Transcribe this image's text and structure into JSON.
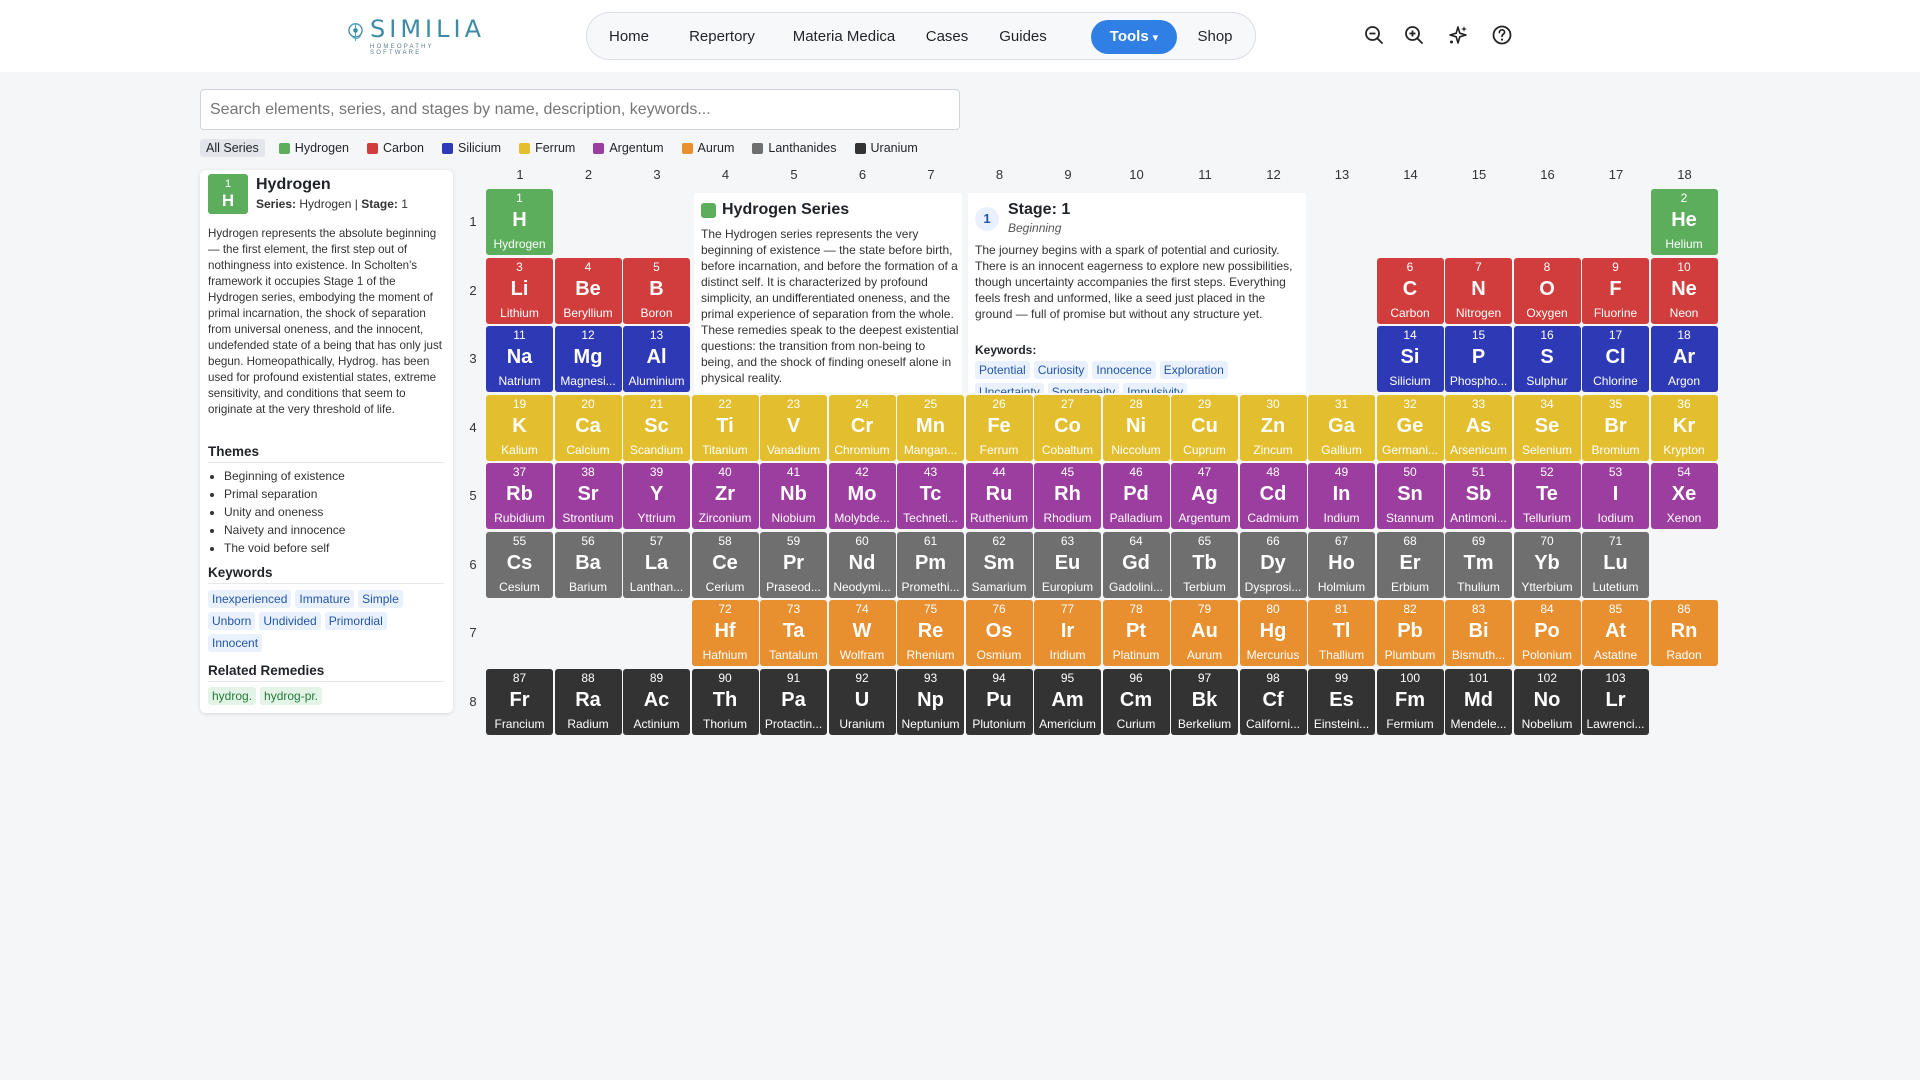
{
  "brand": {
    "name": "SIMILIA",
    "tagline": "HOMEOPATHY SOFTWARE"
  },
  "nav": [
    {
      "label": "Home"
    },
    {
      "label": "Repertory"
    },
    {
      "label": "Materia Medica"
    },
    {
      "label": "Cases"
    },
    {
      "label": "Guides"
    },
    {
      "label": "Tools",
      "active": true,
      "dropdown": true
    },
    {
      "label": "Shop"
    }
  ],
  "header_icons": [
    "zoom-out-icon",
    "zoom-in-icon",
    "sparkles-icon",
    "help-circle-icon"
  ],
  "search": {
    "placeholder": "Search elements, series, and stages by name, description, keywords...",
    "value": ""
  },
  "filters": [
    {
      "label": "All Series",
      "selected": true
    },
    {
      "label": "Hydrogen",
      "color": "#5cae5c"
    },
    {
      "label": "Carbon",
      "color": "#d13c3c"
    },
    {
      "label": "Silicium",
      "color": "#2e3ab5"
    },
    {
      "label": "Ferrum",
      "color": "#e3bf2f"
    },
    {
      "label": "Argentum",
      "color": "#9c3ea0"
    },
    {
      "label": "Aurum",
      "color": "#e88f2f"
    },
    {
      "label": "Lanthanides",
      "color": "#6f6f6f"
    },
    {
      "label": "Uranium",
      "color": "#333333"
    }
  ],
  "series_colors": {
    "hydrogen": "#5cae5c",
    "carbon": "#d13c3c",
    "silicium": "#2e3ab5",
    "ferrum": "#e3bf2f",
    "argentum": "#9c3ea0",
    "lanthanides": "#6f6f6f",
    "aurum": "#e88f2f",
    "uranium": "#333333"
  },
  "columns": [
    "1",
    "2",
    "3",
    "4",
    "5",
    "6",
    "7",
    "8",
    "9",
    "10",
    "11",
    "12",
    "13",
    "14",
    "15",
    "16",
    "17",
    "18"
  ],
  "rows": [
    "1",
    "2",
    "3",
    "4",
    "5",
    "6",
    "7",
    "8"
  ],
  "elements": [
    {
      "n": "1",
      "s": "H",
      "name": "Hydrogen",
      "series": "hydrogen",
      "row": 1,
      "col": 1
    },
    {
      "n": "2",
      "s": "He",
      "name": "Helium",
      "series": "hydrogen",
      "row": 1,
      "col": 18
    },
    {
      "n": "3",
      "s": "Li",
      "name": "Lithium",
      "series": "carbon",
      "row": 2,
      "col": 1
    },
    {
      "n": "4",
      "s": "Be",
      "name": "Beryllium",
      "series": "carbon",
      "row": 2,
      "col": 2
    },
    {
      "n": "5",
      "s": "B",
      "name": "Boron",
      "series": "carbon",
      "row": 2,
      "col": 3
    },
    {
      "n": "6",
      "s": "C",
      "name": "Carbon",
      "series": "carbon",
      "row": 2,
      "col": 14
    },
    {
      "n": "7",
      "s": "N",
      "name": "Nitrogen",
      "series": "carbon",
      "row": 2,
      "col": 15
    },
    {
      "n": "8",
      "s": "O",
      "name": "Oxygen",
      "series": "carbon",
      "row": 2,
      "col": 16
    },
    {
      "n": "9",
      "s": "F",
      "name": "Fluorine",
      "series": "carbon",
      "row": 2,
      "col": 17
    },
    {
      "n": "10",
      "s": "Ne",
      "name": "Neon",
      "series": "carbon",
      "row": 2,
      "col": 18
    },
    {
      "n": "11",
      "s": "Na",
      "name": "Natrium",
      "series": "silicium",
      "row": 3,
      "col": 1
    },
    {
      "n": "12",
      "s": "Mg",
      "name": "Magnesi...",
      "series": "silicium",
      "row": 3,
      "col": 2
    },
    {
      "n": "13",
      "s": "Al",
      "name": "Aluminium",
      "series": "silicium",
      "row": 3,
      "col": 3
    },
    {
      "n": "14",
      "s": "Si",
      "name": "Silicium",
      "series": "silicium",
      "row": 3,
      "col": 14
    },
    {
      "n": "15",
      "s": "P",
      "name": "Phospho...",
      "series": "silicium",
      "row": 3,
      "col": 15
    },
    {
      "n": "16",
      "s": "S",
      "name": "Sulphur",
      "series": "silicium",
      "row": 3,
      "col": 16
    },
    {
      "n": "17",
      "s": "Cl",
      "name": "Chlorine",
      "series": "silicium",
      "row": 3,
      "col": 17
    },
    {
      "n": "18",
      "s": "Ar",
      "name": "Argon",
      "series": "silicium",
      "row": 3,
      "col": 18
    },
    {
      "n": "19",
      "s": "K",
      "name": "Kalium",
      "series": "ferrum",
      "row": 4,
      "col": 1
    },
    {
      "n": "20",
      "s": "Ca",
      "name": "Calcium",
      "series": "ferrum",
      "row": 4,
      "col": 2
    },
    {
      "n": "21",
      "s": "Sc",
      "name": "Scandium",
      "series": "ferrum",
      "row": 4,
      "col": 3
    },
    {
      "n": "22",
      "s": "Ti",
      "name": "Titanium",
      "series": "ferrum",
      "row": 4,
      "col": 4
    },
    {
      "n": "23",
      "s": "V",
      "name": "Vanadium",
      "series": "ferrum",
      "row": 4,
      "col": 5
    },
    {
      "n": "24",
      "s": "Cr",
      "name": "Chromium",
      "series": "ferrum",
      "row": 4,
      "col": 6
    },
    {
      "n": "25",
      "s": "Mn",
      "name": "Mangan...",
      "series": "ferrum",
      "row": 4,
      "col": 7
    },
    {
      "n": "26",
      "s": "Fe",
      "name": "Ferrum",
      "series": "ferrum",
      "row": 4,
      "col": 8
    },
    {
      "n": "27",
      "s": "Co",
      "name": "Cobaltum",
      "series": "ferrum",
      "row": 4,
      "col": 9
    },
    {
      "n": "28",
      "s": "Ni",
      "name": "Niccolum",
      "series": "ferrum",
      "row": 4,
      "col": 10
    },
    {
      "n": "29",
      "s": "Cu",
      "name": "Cuprum",
      "series": "ferrum",
      "row": 4,
      "col": 11
    },
    {
      "n": "30",
      "s": "Zn",
      "name": "Zincum",
      "series": "ferrum",
      "row": 4,
      "col": 12
    },
    {
      "n": "31",
      "s": "Ga",
      "name": "Gallium",
      "series": "ferrum",
      "row": 4,
      "col": 13
    },
    {
      "n": "32",
      "s": "Ge",
      "name": "Germani...",
      "series": "ferrum",
      "row": 4,
      "col": 14
    },
    {
      "n": "33",
      "s": "As",
      "name": "Arsenicum",
      "series": "ferrum",
      "row": 4,
      "col": 15
    },
    {
      "n": "34",
      "s": "Se",
      "name": "Selenium",
      "series": "ferrum",
      "row": 4,
      "col": 16
    },
    {
      "n": "35",
      "s": "Br",
      "name": "Bromium",
      "series": "ferrum",
      "row": 4,
      "col": 17
    },
    {
      "n": "36",
      "s": "Kr",
      "name": "Krypton",
      "series": "ferrum",
      "row": 4,
      "col": 18
    },
    {
      "n": "37",
      "s": "Rb",
      "name": "Rubidium",
      "series": "argentum",
      "row": 5,
      "col": 1
    },
    {
      "n": "38",
      "s": "Sr",
      "name": "Strontium",
      "series": "argentum",
      "row": 5,
      "col": 2
    },
    {
      "n": "39",
      "s": "Y",
      "name": "Yttrium",
      "series": "argentum",
      "row": 5,
      "col": 3
    },
    {
      "n": "40",
      "s": "Zr",
      "name": "Zirconium",
      "series": "argentum",
      "row": 5,
      "col": 4
    },
    {
      "n": "41",
      "s": "Nb",
      "name": "Niobium",
      "series": "argentum",
      "row": 5,
      "col": 5
    },
    {
      "n": "42",
      "s": "Mo",
      "name": "Molybde...",
      "series": "argentum",
      "row": 5,
      "col": 6
    },
    {
      "n": "43",
      "s": "Tc",
      "name": "Techneti...",
      "series": "argentum",
      "row": 5,
      "col": 7
    },
    {
      "n": "44",
      "s": "Ru",
      "name": "Ruthenium",
      "series": "argentum",
      "row": 5,
      "col": 8
    },
    {
      "n": "45",
      "s": "Rh",
      "name": "Rhodium",
      "series": "argentum",
      "row": 5,
      "col": 9
    },
    {
      "n": "46",
      "s": "Pd",
      "name": "Palladium",
      "series": "argentum",
      "row": 5,
      "col": 10
    },
    {
      "n": "47",
      "s": "Ag",
      "name": "Argentum",
      "series": "argentum",
      "row": 5,
      "col": 11
    },
    {
      "n": "48",
      "s": "Cd",
      "name": "Cadmium",
      "series": "argentum",
      "row": 5,
      "col": 12
    },
    {
      "n": "49",
      "s": "In",
      "name": "Indium",
      "series": "argentum",
      "row": 5,
      "col": 13
    },
    {
      "n": "50",
      "s": "Sn",
      "name": "Stannum",
      "series": "argentum",
      "row": 5,
      "col": 14
    },
    {
      "n": "51",
      "s": "Sb",
      "name": "Antimoni...",
      "series": "argentum",
      "row": 5,
      "col": 15
    },
    {
      "n": "52",
      "s": "Te",
      "name": "Tellurium",
      "series": "argentum",
      "row": 5,
      "col": 16
    },
    {
      "n": "53",
      "s": "I",
      "name": "Iodium",
      "series": "argentum",
      "row": 5,
      "col": 17
    },
    {
      "n": "54",
      "s": "Xe",
      "name": "Xenon",
      "series": "argentum",
      "row": 5,
      "col": 18
    },
    {
      "n": "55",
      "s": "Cs",
      "name": "Cesium",
      "series": "lanthanides",
      "row": 6,
      "col": 1
    },
    {
      "n": "56",
      "s": "Ba",
      "name": "Barium",
      "series": "lanthanides",
      "row": 6,
      "col": 2
    },
    {
      "n": "57",
      "s": "La",
      "name": "Lanthan...",
      "series": "lanthanides",
      "row": 6,
      "col": 3
    },
    {
      "n": "58",
      "s": "Ce",
      "name": "Cerium",
      "series": "lanthanides",
      "row": 6,
      "col": 4
    },
    {
      "n": "59",
      "s": "Pr",
      "name": "Praseod...",
      "series": "lanthanides",
      "row": 6,
      "col": 5
    },
    {
      "n": "60",
      "s": "Nd",
      "name": "Neodymi...",
      "series": "lanthanides",
      "row": 6,
      "col": 6
    },
    {
      "n": "61",
      "s": "Pm",
      "name": "Promethi...",
      "series": "lanthanides",
      "row": 6,
      "col": 7
    },
    {
      "n": "62",
      "s": "Sm",
      "name": "Samarium",
      "series": "lanthanides",
      "row": 6,
      "col": 8
    },
    {
      "n": "63",
      "s": "Eu",
      "name": "Europium",
      "series": "lanthanides",
      "row": 6,
      "col": 9
    },
    {
      "n": "64",
      "s": "Gd",
      "name": "Gadolini...",
      "series": "lanthanides",
      "row": 6,
      "col": 10
    },
    {
      "n": "65",
      "s": "Tb",
      "name": "Terbium",
      "series": "lanthanides",
      "row": 6,
      "col": 11
    },
    {
      "n": "66",
      "s": "Dy",
      "name": "Dysprosi...",
      "series": "lanthanides",
      "row": 6,
      "col": 12
    },
    {
      "n": "67",
      "s": "Ho",
      "name": "Holmium",
      "series": "lanthanides",
      "row": 6,
      "col": 13
    },
    {
      "n": "68",
      "s": "Er",
      "name": "Erbium",
      "series": "lanthanides",
      "row": 6,
      "col": 14
    },
    {
      "n": "69",
      "s": "Tm",
      "name": "Thulium",
      "series": "lanthanides",
      "row": 6,
      "col": 15
    },
    {
      "n": "70",
      "s": "Yb",
      "name": "Ytterbium",
      "series": "lanthanides",
      "row": 6,
      "col": 16
    },
    {
      "n": "71",
      "s": "Lu",
      "name": "Lutetium",
      "series": "lanthanides",
      "row": 6,
      "col": 17
    },
    {
      "n": "72",
      "s": "Hf",
      "name": "Hafnium",
      "series": "aurum",
      "row": 7,
      "col": 4
    },
    {
      "n": "73",
      "s": "Ta",
      "name": "Tantalum",
      "series": "aurum",
      "row": 7,
      "col": 5
    },
    {
      "n": "74",
      "s": "W",
      "name": "Wolfram",
      "series": "aurum",
      "row": 7,
      "col": 6
    },
    {
      "n": "75",
      "s": "Re",
      "name": "Rhenium",
      "series": "aurum",
      "row": 7,
      "col": 7
    },
    {
      "n": "76",
      "s": "Os",
      "name": "Osmium",
      "series": "aurum",
      "row": 7,
      "col": 8
    },
    {
      "n": "77",
      "s": "Ir",
      "name": "Iridium",
      "series": "aurum",
      "row": 7,
      "col": 9
    },
    {
      "n": "78",
      "s": "Pt",
      "name": "Platinum",
      "series": "aurum",
      "row": 7,
      "col": 10
    },
    {
      "n": "79",
      "s": "Au",
      "name": "Aurum",
      "series": "aurum",
      "row": 7,
      "col": 11
    },
    {
      "n": "80",
      "s": "Hg",
      "name": "Mercurius",
      "series": "aurum",
      "row": 7,
      "col": 12
    },
    {
      "n": "81",
      "s": "Tl",
      "name": "Thallium",
      "series": "aurum",
      "row": 7,
      "col": 13
    },
    {
      "n": "82",
      "s": "Pb",
      "name": "Plumbum",
      "series": "aurum",
      "row": 7,
      "col": 14
    },
    {
      "n": "83",
      "s": "Bi",
      "name": "Bismuth...",
      "series": "aurum",
      "row": 7,
      "col": 15
    },
    {
      "n": "84",
      "s": "Po",
      "name": "Polonium",
      "series": "aurum",
      "row": 7,
      "col": 16
    },
    {
      "n": "85",
      "s": "At",
      "name": "Astatine",
      "series": "aurum",
      "row": 7,
      "col": 17
    },
    {
      "n": "86",
      "s": "Rn",
      "name": "Radon",
      "series": "aurum",
      "row": 7,
      "col": 18
    },
    {
      "n": "87",
      "s": "Fr",
      "name": "Francium",
      "series": "uranium",
      "row": 8,
      "col": 1
    },
    {
      "n": "88",
      "s": "Ra",
      "name": "Radium",
      "series": "uranium",
      "row": 8,
      "col": 2
    },
    {
      "n": "89",
      "s": "Ac",
      "name": "Actinium",
      "series": "uranium",
      "row": 8,
      "col": 3
    },
    {
      "n": "90",
      "s": "Th",
      "name": "Thorium",
      "series": "uranium",
      "row": 8,
      "col": 4
    },
    {
      "n": "91",
      "s": "Pa",
      "name": "Protactin...",
      "series": "uranium",
      "row": 8,
      "col": 5
    },
    {
      "n": "92",
      "s": "U",
      "name": "Uranium",
      "series": "uranium",
      "row": 8,
      "col": 6
    },
    {
      "n": "93",
      "s": "Np",
      "name": "Neptunium",
      "series": "uranium",
      "row": 8,
      "col": 7
    },
    {
      "n": "94",
      "s": "Pu",
      "name": "Plutonium",
      "series": "uranium",
      "row": 8,
      "col": 8
    },
    {
      "n": "95",
      "s": "Am",
      "name": "Americium",
      "series": "uranium",
      "row": 8,
      "col": 9
    },
    {
      "n": "96",
      "s": "Cm",
      "name": "Curium",
      "series": "uranium",
      "row": 8,
      "col": 10
    },
    {
      "n": "97",
      "s": "Bk",
      "name": "Berkelium",
      "series": "uranium",
      "row": 8,
      "col": 11
    },
    {
      "n": "98",
      "s": "Cf",
      "name": "Californi...",
      "series": "uranium",
      "row": 8,
      "col": 12
    },
    {
      "n": "99",
      "s": "Es",
      "name": "Einsteini...",
      "series": "uranium",
      "row": 8,
      "col": 13
    },
    {
      "n": "100",
      "s": "Fm",
      "name": "Fermium",
      "series": "uranium",
      "row": 8,
      "col": 14
    },
    {
      "n": "101",
      "s": "Md",
      "name": "Mendele...",
      "series": "uranium",
      "row": 8,
      "col": 15
    },
    {
      "n": "102",
      "s": "No",
      "name": "Nobelium",
      "series": "uranium",
      "row": 8,
      "col": 16
    },
    {
      "n": "103",
      "s": "Lr",
      "name": "Lawrenci...",
      "series": "uranium",
      "row": 8,
      "col": 17
    }
  ],
  "selected": {
    "number": "1",
    "symbol": "H",
    "name": "Hydrogen",
    "series_label": "Series:",
    "series": "Hydrogen",
    "stage_label": "Stage:",
    "stage": "1",
    "description": "Hydrogen represents the absolute beginning — the first element, the first step out of nothingness into existence. In Scholten's framework it occupies Stage 1 of the Hydrogen series, embodying the moment of primal incarnation, the shock of separation from universal oneness, and the innocent, undefended state of a being that has only just begun. Homeopathically, Hydrog. has been used for profound existential states, extreme sensitivity, and conditions that seem to originate at the very threshold of life.",
    "themes_title": "Themes",
    "themes": [
      "Beginning of existence",
      "Primal separation",
      "Unity and oneness",
      "Naivety and innocence",
      "The void before self"
    ],
    "keywords_title": "Keywords",
    "keywords": [
      "Inexperienced",
      "Immature",
      "Simple",
      "Unborn",
      "Undivided",
      "Primordial",
      "Innocent"
    ],
    "related_title": "Related Remedies",
    "related": [
      "hydrog.",
      "hydrog-pr."
    ]
  },
  "series_card": {
    "title": "Hydrogen Series",
    "text": "The Hydrogen series represents the very beginning of existence — the state before birth, before incarnation, and before the formation of a distinct self. It is characterized by profound simplicity, an undifferentiated oneness, and the primal experience of separation from the whole. These remedies speak to the deepest existential questions: the transition from non-being to being, and the shock of finding oneself alone in physical reality."
  },
  "stage_card": {
    "number": "1",
    "title": "Stage: 1",
    "subtitle": "Beginning",
    "text": "The journey begins with a spark of potential and curiosity. There is an innocent eagerness to explore new possibilities, though uncertainty accompanies the first steps. Everything feels fresh and unformed, like a seed just placed in the ground — full of promise but without any structure yet.",
    "keywords_label": "Keywords:",
    "keywords": [
      "Potential",
      "Curiosity",
      "Innocence",
      "Exploration",
      "Uncertainty",
      "Spontaneity",
      "Impulsivity"
    ]
  }
}
